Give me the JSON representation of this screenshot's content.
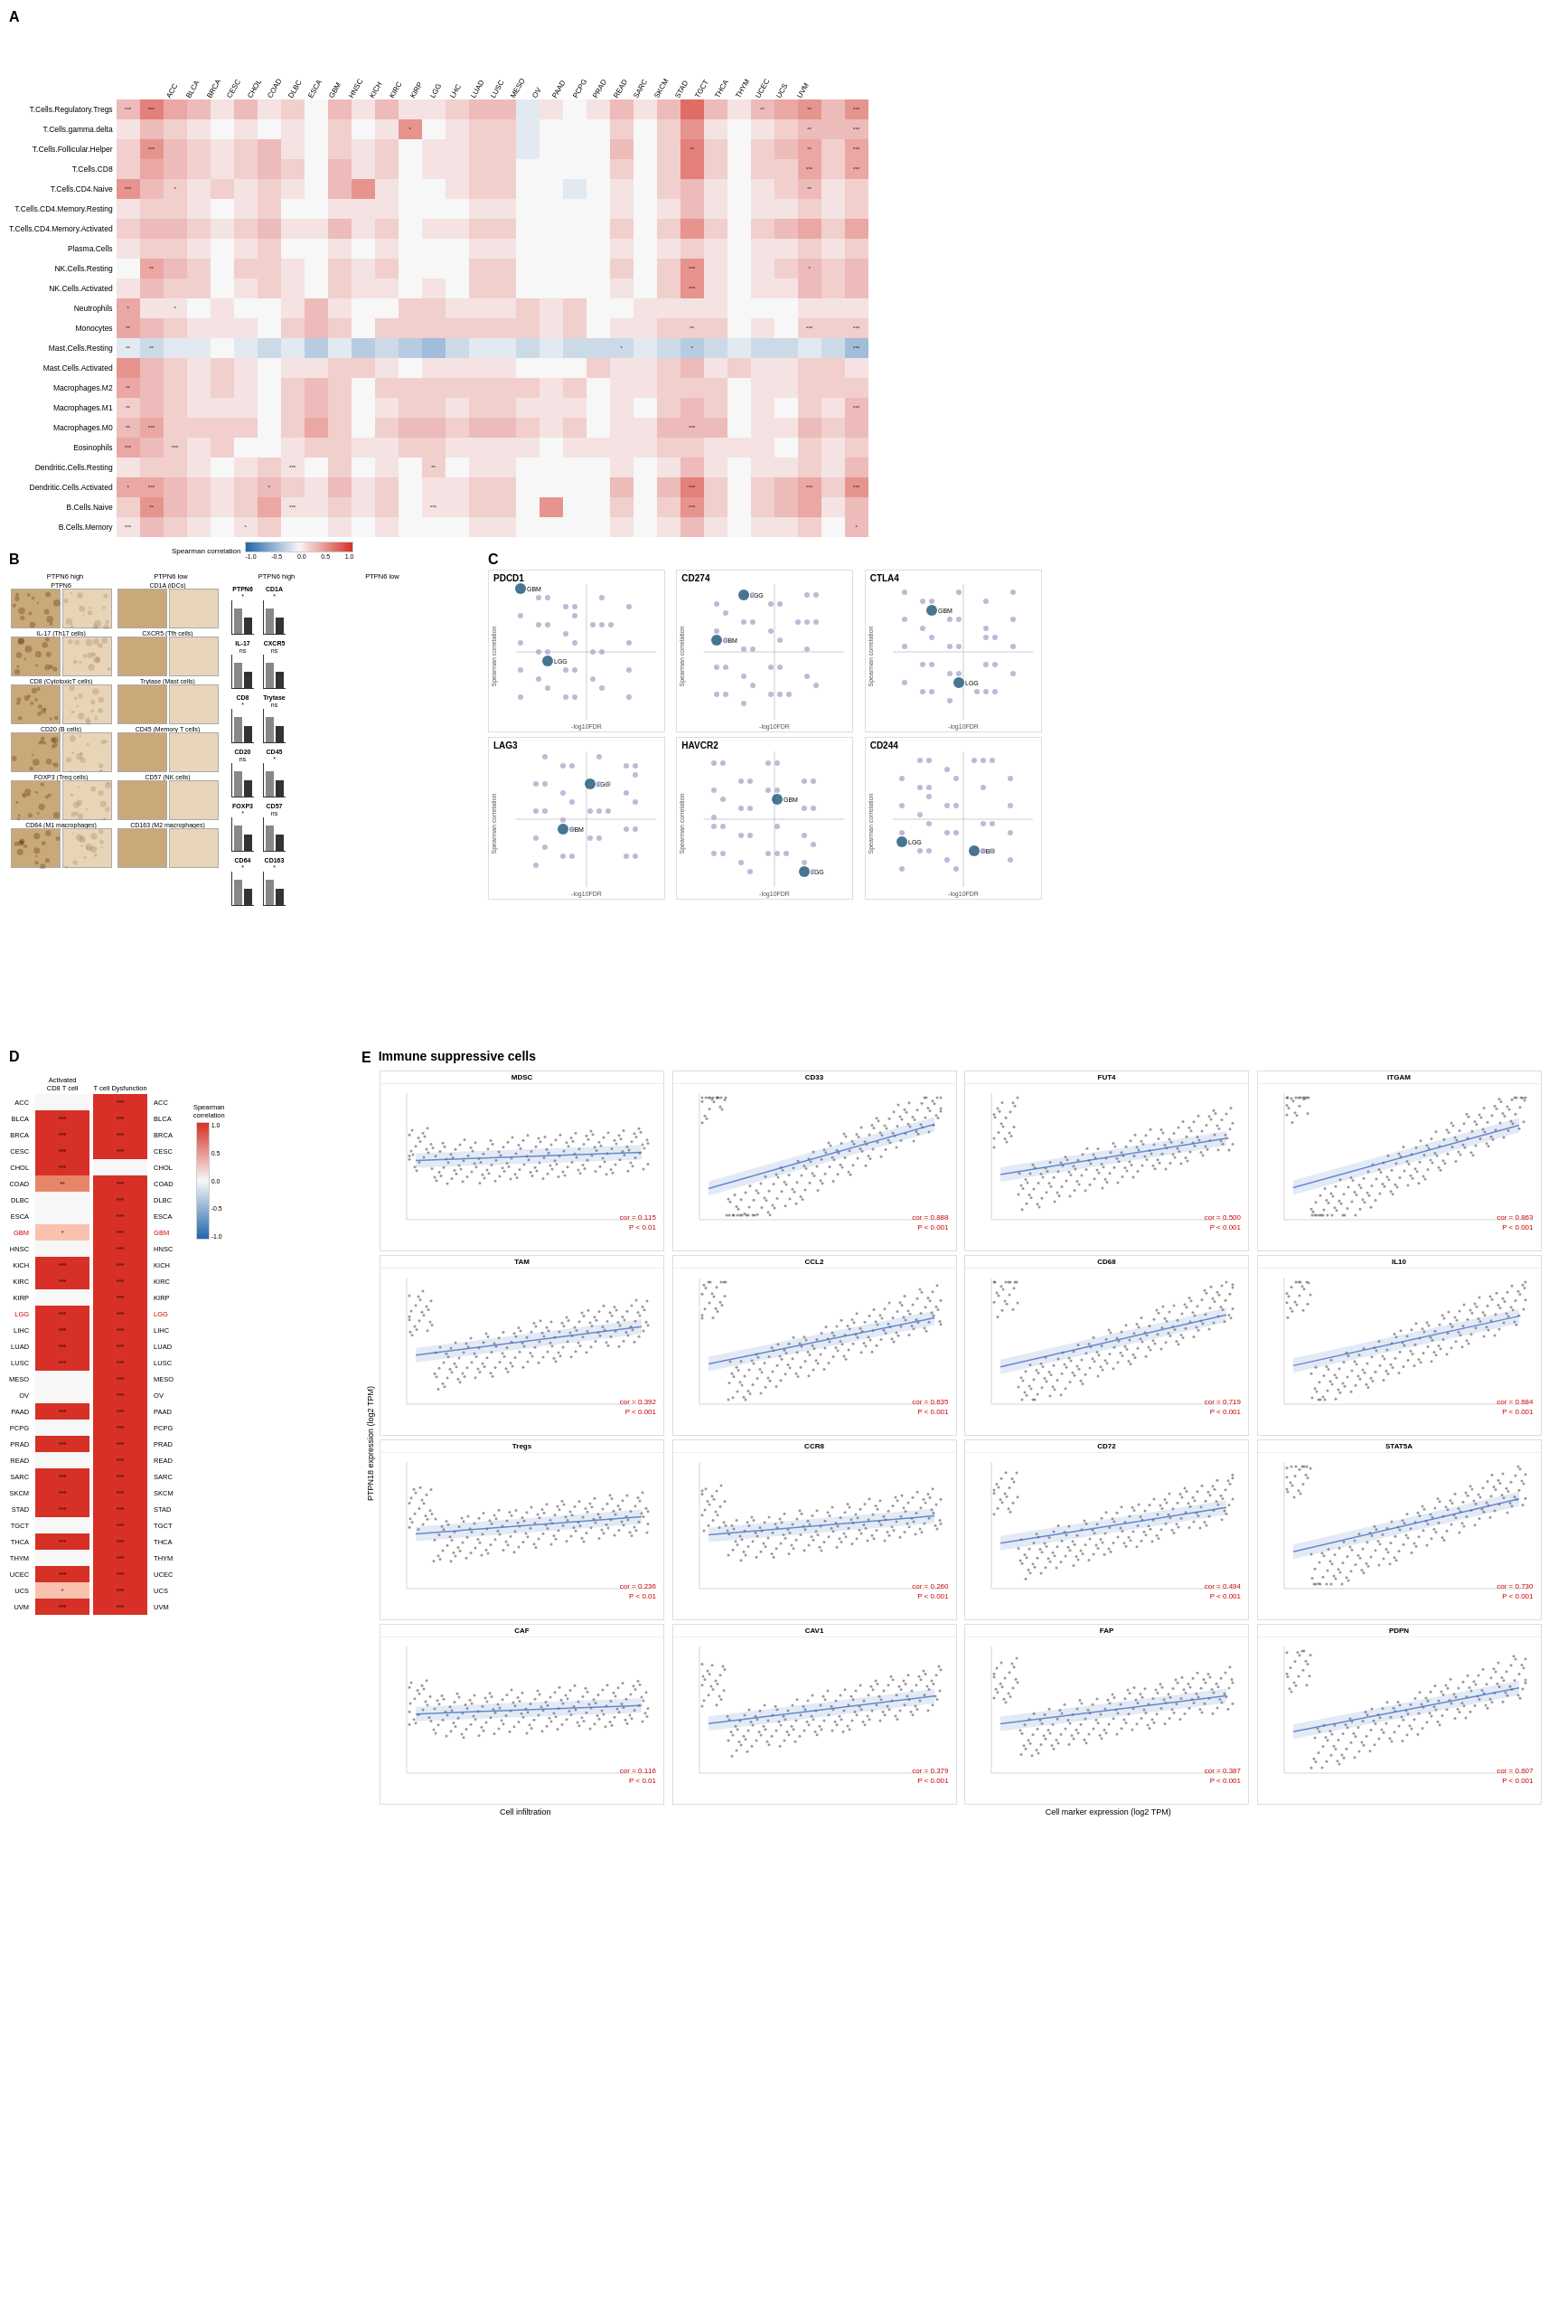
{
  "panelA": {
    "label": "A",
    "colHeaders": [
      "ACC",
      "BLCA",
      "BRCA",
      "CESC",
      "CHOL",
      "COAD",
      "DLBC",
      "ESCA",
      "GBM",
      "HNSC",
      "KICH",
      "KIRC",
      "KIRP",
      "LGG",
      "LHC",
      "LUAD",
      "LUSC",
      "MESO",
      "OV",
      "PAAD",
      "PCPG",
      "PRAD",
      "READ",
      "SARC",
      "SKCM",
      "STAD",
      "TGCT",
      "THCA",
      "THYM",
      "UCEC",
      "UCS",
      "UVM"
    ],
    "rowLabels": [
      "T.Cells.Regulatory.Tregs",
      "T.Cells.gamma.delta",
      "T.Cells.Follicular.Helper",
      "T.Cells.CD8",
      "T.Cells.CD4.Naive",
      "T.Cells.CD4.Memory.Resting",
      "T.Cells.CD4.Memory.Activated",
      "Plasma.Cells",
      "NK.Cells.Resting",
      "NK.Cells.Activated",
      "Neutrophils",
      "Monocytes",
      "Mast.Cells.Resting",
      "Mast.Cells.Activated",
      "Macrophages.M2",
      "Macrophages.M1",
      "Macrophages.M0",
      "Eosinophils",
      "Dendritic.Cells.Resting",
      "Dendritic.Cells.Activated",
      "B.Cells.Naive",
      "B.Cells.Memory"
    ],
    "legendLabel": "Spearman correlation",
    "legendMin": "-1.0",
    "legendMid1": "-0.5",
    "legendMid2": "0.0",
    "legendMid3": "0.5",
    "legendMax": "1.0"
  },
  "panelB": {
    "label": "B",
    "headerHigh": "PTPN6 high",
    "headerLow": "PTPN6 low",
    "ihcPairs": [
      {
        "label": "PTPN6",
        "label2": "CD1A (iDCs)"
      },
      {
        "label": "IL-17 (Th17 cells)",
        "label2": "CXCR5 (Tfh cells)"
      },
      {
        "label": "CD8 (CytotoxicT cells)",
        "label2": "Trytase (Mast cells)"
      },
      {
        "label": "CD20 (B cells)",
        "label2": "CD45 (Memory T cells)"
      },
      {
        "label": "FOXP3 (Treg cells)",
        "label2": "CD57 (NK cells)"
      },
      {
        "label": "CD64 (M1 macrophages)",
        "label2": "CD163 (M2 macrophages)"
      }
    ],
    "barCharts": [
      {
        "label": "PTPN6",
        "sig": "*"
      },
      {
        "label": "CD1A",
        "sig": "*"
      },
      {
        "label": "IL-17",
        "sig": "ns"
      },
      {
        "label": "CXCR5",
        "sig": "ns"
      },
      {
        "label": "CD8",
        "sig": "*"
      },
      {
        "label": "Trytase",
        "sig": "ns"
      },
      {
        "label": "CD20",
        "sig": "ns"
      },
      {
        "label": "CD45",
        "sig": "*"
      },
      {
        "label": "FOXP3",
        "sig": "*"
      },
      {
        "label": "CD57",
        "sig": "ns"
      },
      {
        "label": "CD64",
        "sig": "*"
      },
      {
        "label": "CD163",
        "sig": "*"
      }
    ]
  },
  "panelC": {
    "label": "C",
    "plots": [
      {
        "title": "PDCD1",
        "highlight": [
          "GBM",
          "LGG"
        ]
      },
      {
        "title": "CD274",
        "highlight": [
          "GBM",
          "LGG"
        ]
      },
      {
        "title": "CTLA4",
        "highlight": [
          "GBM",
          "LGG"
        ]
      },
      {
        "title": "LAG3",
        "highlight": [
          "GBM",
          "LGG"
        ]
      },
      {
        "title": "HAVCR2",
        "highlight": [
          "GBM",
          "LGG"
        ]
      },
      {
        "title": "CD244",
        "highlight": [
          "GBM",
          "LGG"
        ]
      }
    ],
    "axisX": "-log10FDR",
    "axisY": "Spearman correlation"
  },
  "panelD": {
    "label": "D",
    "col1Header": "Activated\nCD8 T cell",
    "col2Header": "T cell Dysfunction",
    "cancers": [
      "ACC",
      "BLCA",
      "BRCA",
      "CESC",
      "CHOL",
      "COAD",
      "DLBC",
      "ESCA",
      "GBM",
      "HNSC",
      "KICH",
      "KIRC",
      "KIRP",
      "LGG",
      "LIHC",
      "LUAD",
      "LUSC",
      "MESO",
      "OV",
      "PAAD",
      "PCPG",
      "PRAD",
      "READ",
      "SARC",
      "SKCM",
      "STAD",
      "TGCT",
      "THCA",
      "THYM",
      "UCEC",
      "UCS",
      "UVM"
    ],
    "col1Values": [
      "",
      "***",
      "***",
      "***",
      "***",
      "**",
      "",
      "",
      "*",
      "",
      "***",
      "***",
      "",
      "***",
      "***",
      "***",
      "***",
      "",
      "",
      "***",
      "",
      "***",
      "",
      "***",
      "***",
      "***",
      "",
      "***",
      "",
      "***",
      "*",
      "***"
    ],
    "col2Values": [
      "***",
      "***",
      "***",
      "***",
      "",
      "***",
      "***",
      "***",
      "***",
      "***",
      "***",
      "***",
      "***",
      "***",
      "***",
      "***",
      "***",
      "***",
      "***",
      "***",
      "***",
      "***",
      "***",
      "***",
      "***",
      "***",
      "***",
      "***",
      "***",
      "***",
      "***",
      "***"
    ],
    "col1Colors": [
      "#f7f7f7",
      "#d73027",
      "#d73027",
      "#d73027",
      "#d73027",
      "#e88568",
      "#f7f7f7",
      "#f7f7f7",
      "#f9c2ae",
      "#f7f7f7",
      "#d73027",
      "#d73027",
      "#f7f7f7",
      "#d73027",
      "#d73027",
      "#d73027",
      "#d73027",
      "#f7f7f7",
      "#f7f7f7",
      "#d73027",
      "#f7f7f7",
      "#d73027",
      "#f7f7f7",
      "#d73027",
      "#d73027",
      "#d73027",
      "#f7f7f7",
      "#d73027",
      "#f7f7f7",
      "#d73027",
      "#f9c2ae",
      "#d73027"
    ],
    "col2Colors": [
      "#d73027",
      "#d73027",
      "#d73027",
      "#d73027",
      "#f7f7f7",
      "#d73027",
      "#d73027",
      "#d73027",
      "#d73027",
      "#d73027",
      "#d73027",
      "#d73027",
      "#d73027",
      "#d73027",
      "#d73027",
      "#d73027",
      "#d73027",
      "#d73027",
      "#d73027",
      "#d73027",
      "#d73027",
      "#d73027",
      "#d73027",
      "#d73027",
      "#d73027",
      "#d73027",
      "#d73027",
      "#d73027",
      "#d73027",
      "#d73027",
      "#d73027",
      "#d73027"
    ],
    "highlightCancers": [
      "GBM",
      "LGG"
    ],
    "legendLabel": "Spearman correlation",
    "legendValues": [
      "1.0",
      "0.5",
      "0.0",
      "-0.5",
      "1.0"
    ]
  },
  "panelE": {
    "label": "E",
    "title": "Immune suppressive cells",
    "plots": [
      {
        "title": "MDSC",
        "cor": "cor = 0.115",
        "pval": "P < 0.01",
        "type": "scatter"
      },
      {
        "title": "CD33",
        "cor": "cor = 0.888",
        "pval": "P < 0.001",
        "type": "scatter"
      },
      {
        "title": "FUT4",
        "cor": "cor = 0.500",
        "pval": "P < 0.001",
        "type": "scatter"
      },
      {
        "title": "ITGAM",
        "cor": "cor = 0.863",
        "pval": "P < 0.001",
        "type": "scatter"
      },
      {
        "title": "TAM",
        "cor": "cor = 0.392",
        "pval": "P < 0.001",
        "type": "scatter"
      },
      {
        "title": "CCL2",
        "cor": "cor = 0.635",
        "pval": "P < 0.001",
        "type": "scatter"
      },
      {
        "title": "CD68",
        "cor": "cor = 0.719",
        "pval": "P < 0.001",
        "type": "scatter"
      },
      {
        "title": "IL10",
        "cor": "cor = 0.684",
        "pval": "P < 0.001",
        "type": "scatter"
      },
      {
        "title": "Tregs",
        "cor": "cor = 0.236",
        "pval": "P < 0.01",
        "type": "scatter"
      },
      {
        "title": "CCR8",
        "cor": "cor = 0.260",
        "pval": "P < 0.001",
        "type": "scatter"
      },
      {
        "title": "CD72",
        "cor": "cor = 0.494",
        "pval": "P < 0.001",
        "type": "scatter"
      },
      {
        "title": "STAT5A",
        "cor": "cor = 0.730",
        "pval": "P < 0.001",
        "type": "scatter"
      },
      {
        "title": "CAF",
        "cor": "cor = 0.116",
        "pval": "P < 0.01",
        "type": "scatter"
      },
      {
        "title": "CAV1",
        "cor": "cor = 0.379",
        "pval": "P < 0.001",
        "type": "scatter"
      },
      {
        "title": "FAP",
        "cor": "cor = 0.387",
        "pval": "P < 0.001",
        "type": "scatter"
      },
      {
        "title": "PDPN",
        "cor": "cor = 0.607",
        "pval": "P < 0.001",
        "type": "scatter"
      }
    ],
    "axisXLeft": "Cell infiltration",
    "axisXRight": "Cell marker expression (log2 TPM)",
    "axisY": "PTPN18 expression (log2 TPM)"
  }
}
